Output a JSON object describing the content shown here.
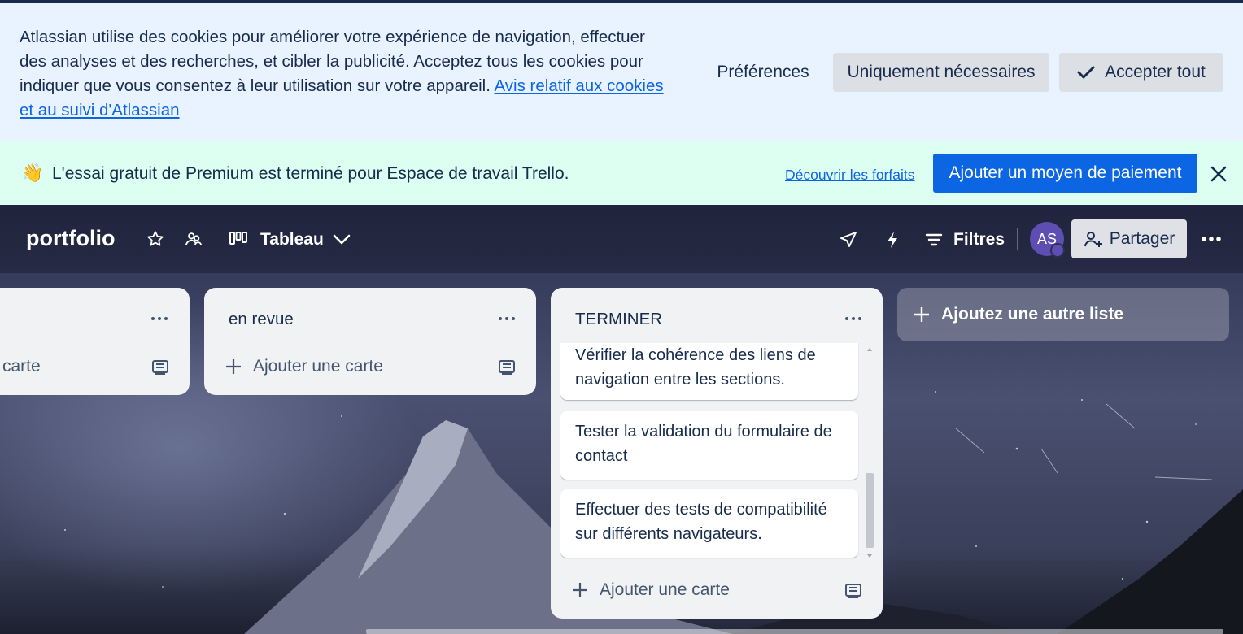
{
  "cookie_banner": {
    "message": "Atlassian utilise des cookies pour améliorer votre expérience de navigation, effectuer des analyses et des recherches, et cibler la publicité. Acceptez tous les cookies pour indiquer que vous consentez à leur utilisation sur votre appareil.",
    "link": "Avis relatif aux cookies et au suivi d'Atlassian",
    "preferences_label": "Préférences",
    "necessary_label": "Uniquement nécessaires",
    "accept_label": "Accepter tout"
  },
  "premium_banner": {
    "emoji": "👋",
    "message": "L'essai gratuit de Premium est terminé pour Espace de travail Trello.",
    "link": "Découvrir les forfaits",
    "button_label": "Ajouter un moyen de paiement"
  },
  "board_header": {
    "title": "portfolio",
    "view_label": "Tableau",
    "filters_label": "Filtres",
    "avatar_initials": "AS",
    "share_label": "Partager"
  },
  "lists": [
    {
      "title": "",
      "add_card_label": "carte"
    },
    {
      "title": "en revue",
      "add_card_label": "Ajouter une carte"
    },
    {
      "title": "TERMINER",
      "add_card_label": "Ajouter une carte",
      "cards": [
        "Vérifier la cohérence des liens de navigation entre les sections.",
        "Tester la validation du formulaire de contact",
        "Effectuer des tests de compatibilité sur différents navigateurs."
      ]
    }
  ],
  "add_list_label": "Ajoutez une autre liste",
  "colors": {
    "cookie_bg": "#e9f2ff",
    "premium_bg": "#dcfff1",
    "primary_blue": "#0c66e4",
    "text_dark": "#172b4d",
    "avatar": "#5e4db2"
  },
  "icons": {
    "star": "star-icon",
    "workspace": "workspace-visibility-icon",
    "board_view": "board-view-icon",
    "chevron": "chevron-down-icon",
    "power_ups": "rocket-icon",
    "automation": "lightning-icon",
    "filter": "filter-icon",
    "share": "add-person-icon",
    "more": "more-horizontal-icon",
    "close": "close-icon",
    "check": "check-icon",
    "template": "card-template-icon"
  }
}
